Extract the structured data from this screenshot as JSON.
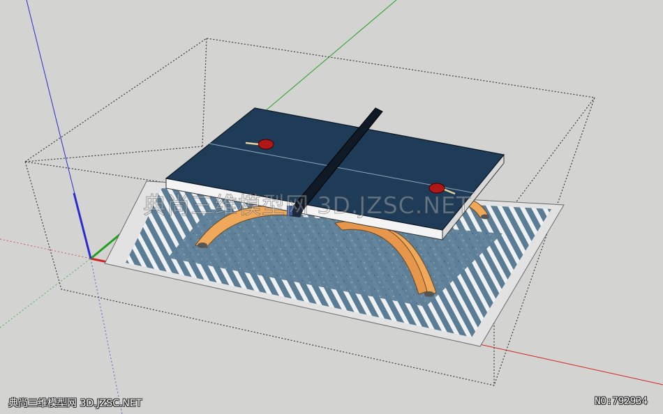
{
  "viewport": {
    "background_color": "#d3d3d1"
  },
  "watermark": {
    "center_text": "典尚三维模型网 3D.JZSC.NET",
    "caption_left": "典尚三维模型网 3D.JZSC.NET",
    "caption_right_prefix": "NO:",
    "caption_right_number": "792934"
  },
  "colors": {
    "axis_red": "#d22222",
    "axis_green": "#1fa01f",
    "axis_blue": "#2a2ad0",
    "table_top": "#1e3b57",
    "table_edge": "#f4f4f4",
    "net": "#0f1a26",
    "legs": "#f0a85a",
    "floor_mat": "#5b7d95",
    "mat_border": "#dcdcdc",
    "paddle": "#b01818"
  },
  "icons": {
    "paddle_left": "ping-pong-paddle-icon",
    "paddle_right": "ping-pong-paddle-icon",
    "axis_origin": "axis-origin-icon"
  }
}
